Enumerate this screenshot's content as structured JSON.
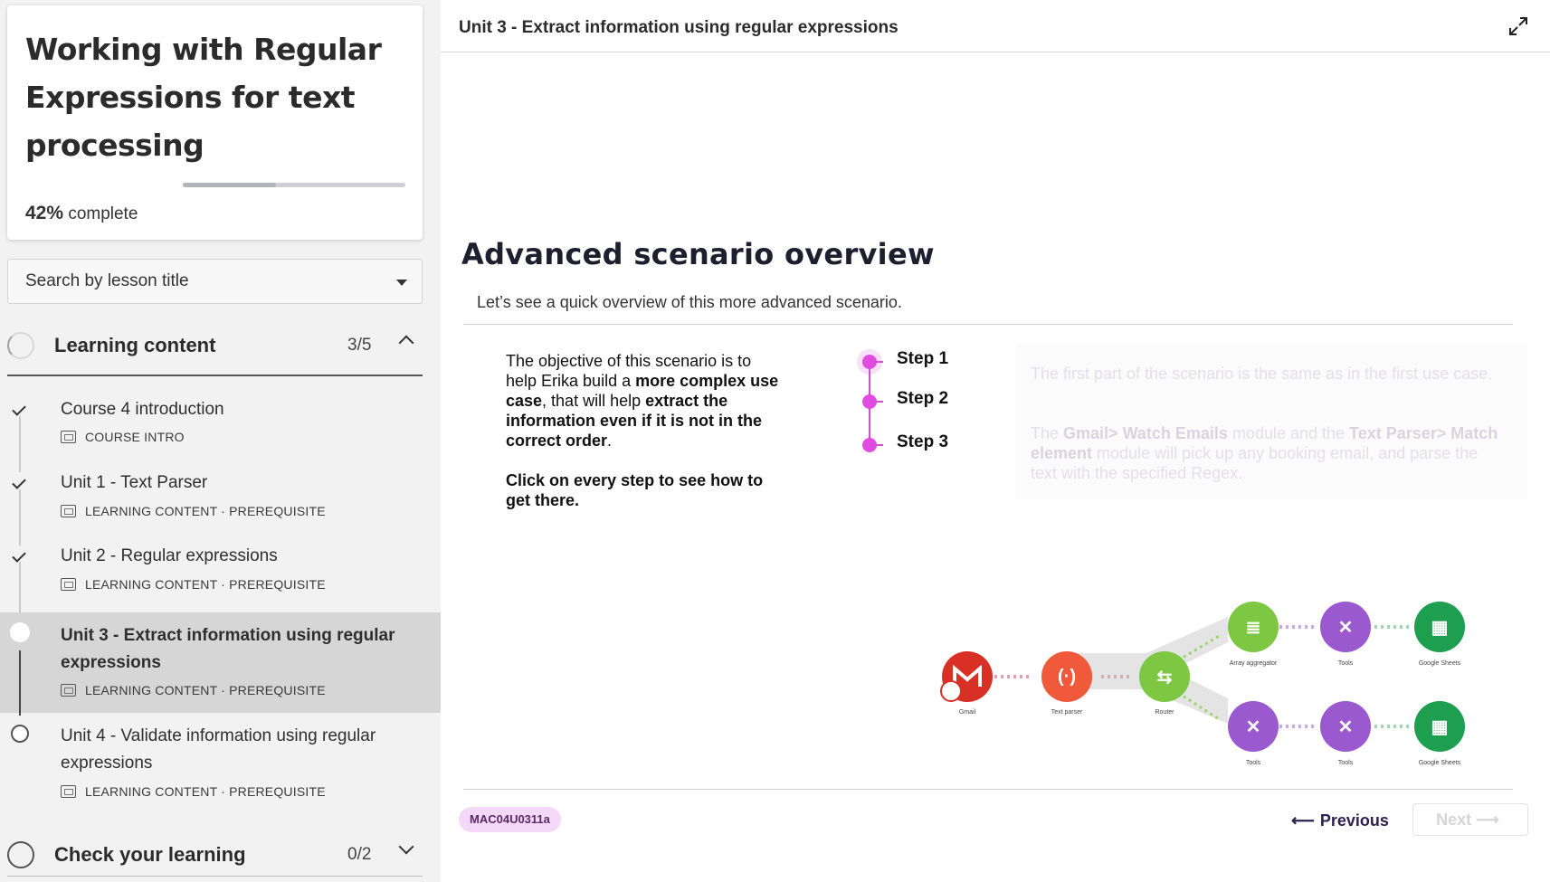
{
  "course": {
    "title": "Working with Regular Expressions for text processing",
    "progress_percent": "42%",
    "progress_suffix": "complete",
    "progress_fraction": 0.42
  },
  "search": {
    "placeholder": "Search by lesson title"
  },
  "sections": [
    {
      "label": "Learning content",
      "count": "3/5"
    },
    {
      "label": "Check your learning",
      "count": "0/2"
    }
  ],
  "lessons": [
    {
      "title": "Course 4 introduction",
      "meta": "COURSE INTRO",
      "status": "done"
    },
    {
      "title": "Unit 1 - Text Parser",
      "meta": "LEARNING CONTENT · PREREQUISITE",
      "status": "done"
    },
    {
      "title": "Unit 2 - Regular expressions",
      "meta": "LEARNING CONTENT · PREREQUISITE",
      "status": "done"
    },
    {
      "title": "Unit 3 - Extract information using regular expressions",
      "meta": "LEARNING CONTENT · PREREQUISITE",
      "status": "current"
    },
    {
      "title": "Unit 4 - Validate information using regular expressions",
      "meta": "LEARNING CONTENT · PREREQUISITE",
      "status": "todo"
    }
  ],
  "main": {
    "unit_title": "Unit 3 - Extract information using regular expressions",
    "heading": "Advanced scenario overview",
    "subheading": "Let’s see a quick overview of this more advanced scenario.",
    "objective": {
      "p1_a": "The objective of this scenario is to help Erika build a ",
      "p1_b": "more complex use case",
      "p1_c": ", that will help ",
      "p1_d": "extract the information even if it is not in the correct order",
      "p1_e": ".",
      "cta": "Click on every step to see how to get there."
    },
    "steps": [
      "Step 1",
      "Step 2",
      "Step 3"
    ],
    "step_panel": {
      "p1": "The first part of the scenario is the same as in the first use case.",
      "p2_a": "The ",
      "p2_b": "Gmail> Watch Emails",
      "p2_c": " module and the ",
      "p2_d": "Text Parser> Match element",
      "p2_e": " module will pick up any booking email, and parse the text with the specified Regex."
    },
    "flow_labels": {
      "gmail": "Gmail",
      "text_parser": "Text parser",
      "router": "Router",
      "array_aggregator": "Array aggregator",
      "tools": "Tools",
      "google_sheets": "Google Sheets"
    },
    "code": "MAC04U0311a",
    "previous": "Previous",
    "next": "Next"
  },
  "colors": {
    "accent": "#e04be0",
    "gmail": "#d93025",
    "text_parser": "#f05a3a",
    "router": "#7dc743",
    "array_aggregator": "#7dc743",
    "tools": "#9b59d0",
    "google_sheets": "#1e9e4f"
  }
}
